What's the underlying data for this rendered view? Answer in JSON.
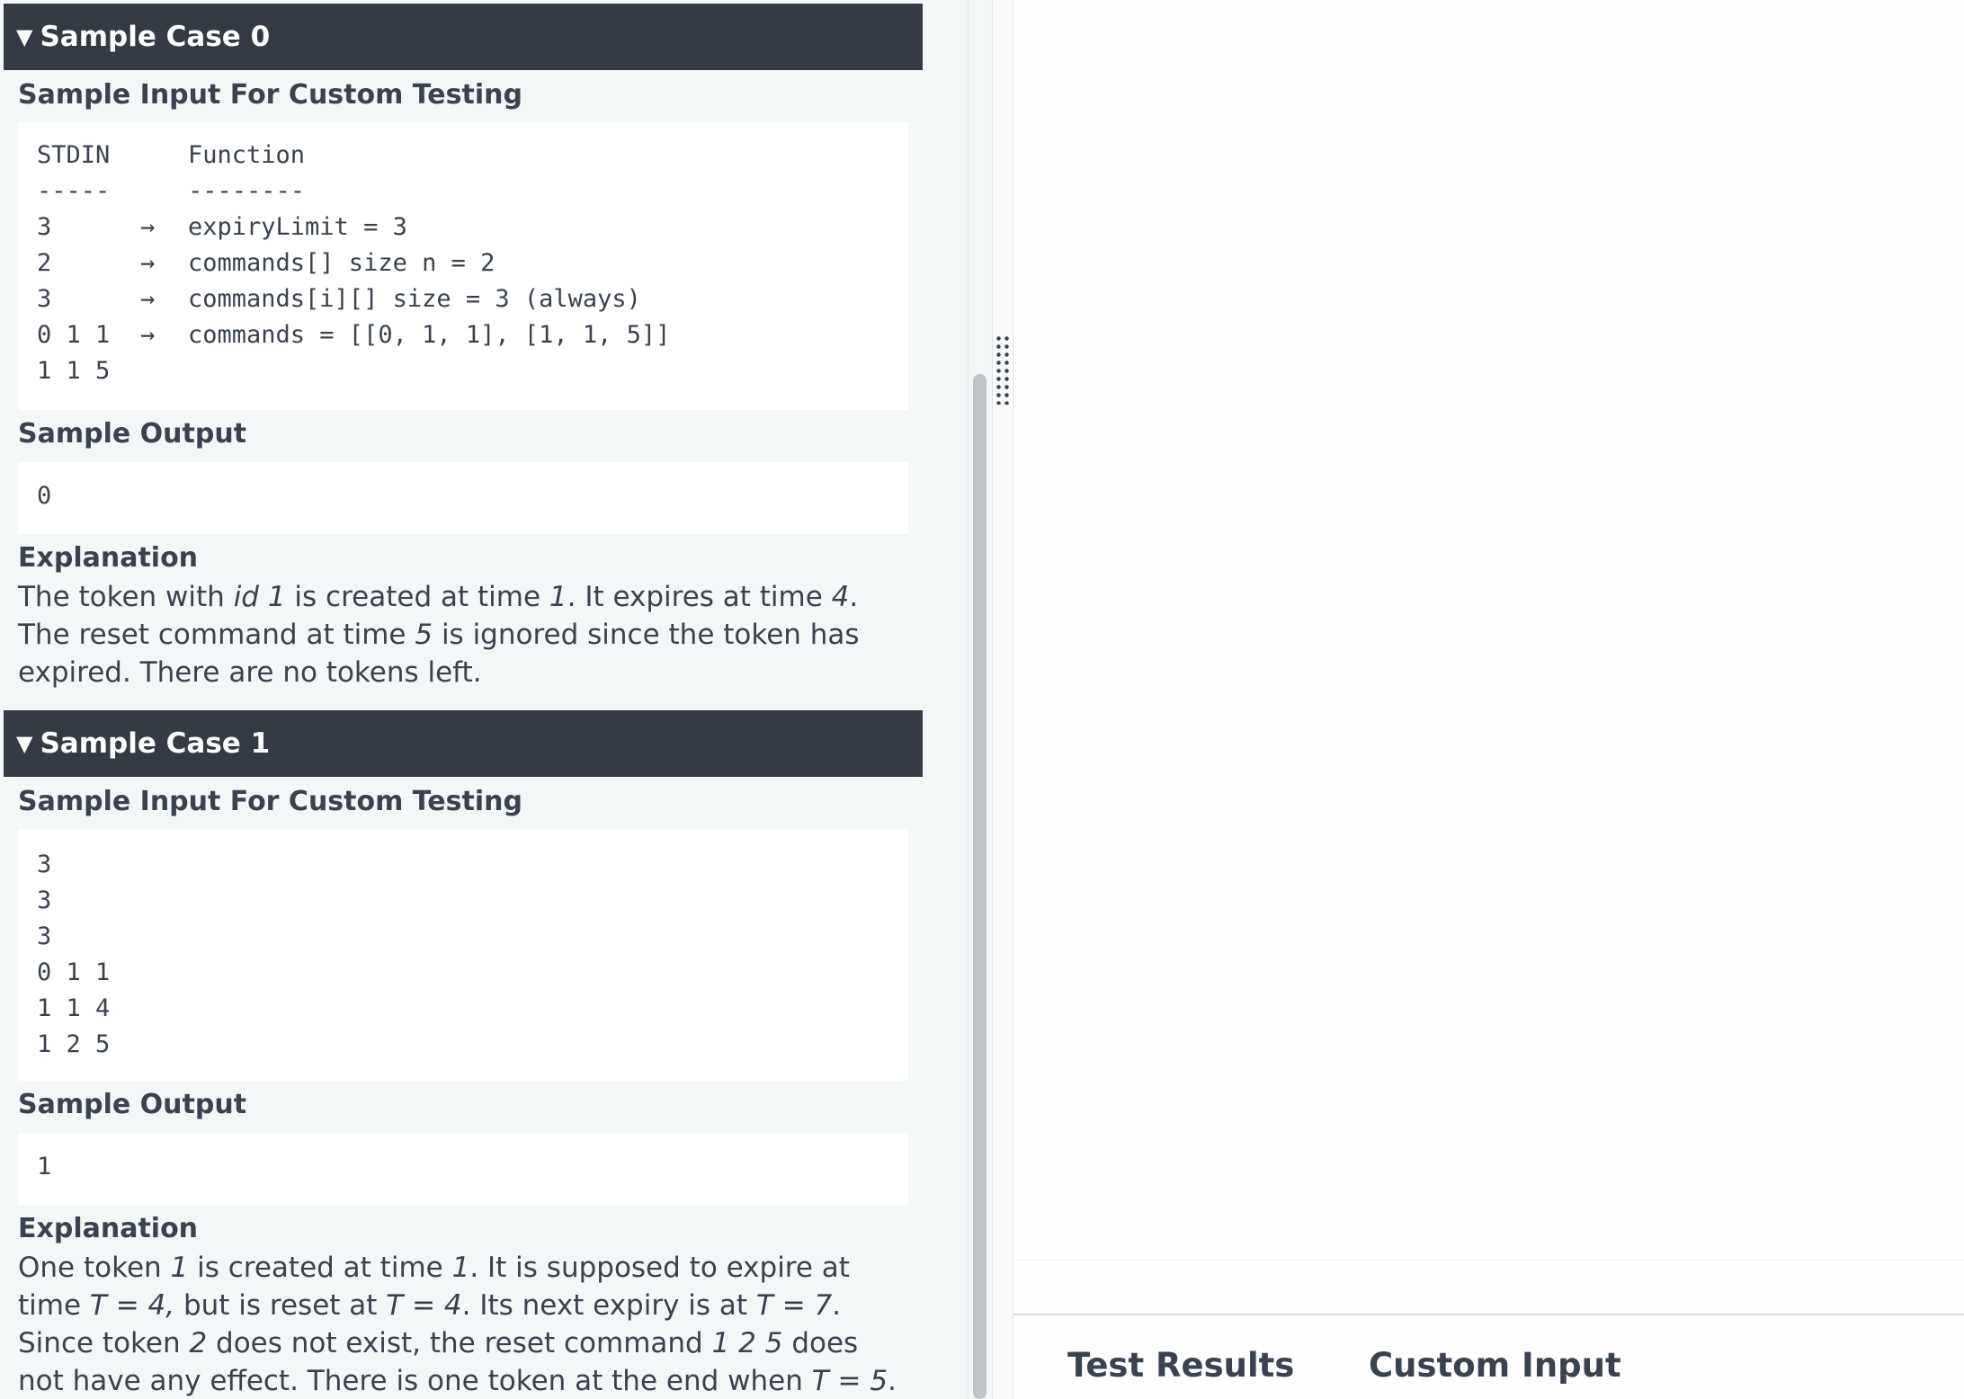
{
  "sample_cases": [
    {
      "header": "Sample Case 0",
      "input_heading": "Sample Input For Custom Testing",
      "input_lines": [
        {
          "stdin": "STDIN",
          "arrow": "",
          "func": "Function"
        },
        {
          "stdin": "-----",
          "arrow": "",
          "func": "--------"
        },
        {
          "stdin": "3",
          "arrow": "→",
          "func": "expiryLimit = 3"
        },
        {
          "stdin": "2",
          "arrow": "→",
          "func": "commands[] size n = 2"
        },
        {
          "stdin": "3",
          "arrow": "→",
          "func": "commands[i][] size = 3 (always)"
        },
        {
          "stdin": "0 1 1",
          "arrow": "→",
          "func": "commands = [[0, 1, 1], [1, 1, 5]]"
        },
        {
          "stdin": "1 1 5",
          "arrow": "",
          "func": ""
        }
      ],
      "output_heading": "Sample Output",
      "output": "0",
      "explanation_heading": "Explanation",
      "explanation": {
        "t1": "The token with ",
        "i1": "id 1",
        "t2": " is created at time ",
        "i2": "1",
        "t3": ". It expires at time ",
        "i3": "4",
        "t4": ". The reset command at time ",
        "i4": "5",
        "t5": " is ignored since the token has expired. There are no tokens left."
      }
    },
    {
      "header": "Sample Case 1",
      "input_heading": "Sample Input For Custom Testing",
      "input_lines": [
        "3",
        "3",
        "3",
        "0 1 1",
        "1 1 4",
        "1 2 5"
      ],
      "output_heading": "Sample Output",
      "output": "1",
      "explanation_heading": "Explanation",
      "explanation": {
        "t1": "One token ",
        "i1": "1",
        "t2": " is created at time ",
        "i2": "1",
        "t3": ". It is supposed to expire at time ",
        "i3": "T = 4,",
        "t4": " but is reset at ",
        "i4": "T = 4",
        "t5": ". Its next expiry is at ",
        "i5": "T = 7",
        "t6": ". Since token ",
        "i6": "2",
        "t7": " does not exist, the reset command ",
        "i7": "1 2 5",
        "t8": " does not have any effect. There is one token at the end when ",
        "i8": "T = 5",
        "t9": "."
      }
    }
  ],
  "bottom_tabs": {
    "test_results": "Test Results",
    "custom_input": "Custom Input"
  },
  "icons": {
    "collapse": "triangle-down-icon",
    "splitter": "drag-handle-icon"
  }
}
